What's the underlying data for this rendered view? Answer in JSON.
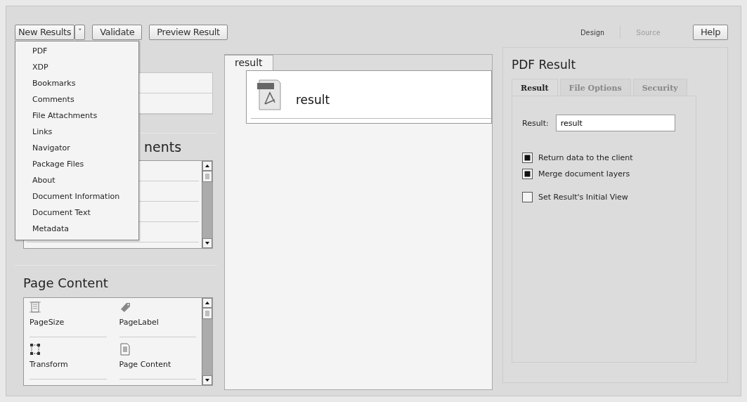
{
  "toolbar": {
    "new_results": "New Results",
    "caret": "˅",
    "buttons": [
      "Validate",
      "Preview Result"
    ],
    "views": [
      {
        "label": "Design",
        "selected": true
      },
      {
        "label": "Source",
        "selected": false
      }
    ],
    "help": "Help"
  },
  "menu": [
    "PDF",
    "XDP",
    "Bookmarks",
    "Comments",
    "File Attachments",
    "Links",
    "Navigator",
    "Package Files",
    "About",
    "Document Information",
    "Document Text",
    "Metadata"
  ],
  "left": {
    "components_heading": "nents",
    "page_content": {
      "title": "Page Content",
      "items": [
        {
          "label": "PageSize",
          "kind": "pagesize"
        },
        {
          "label": "PageLabel",
          "kind": "tag"
        },
        {
          "label": "Transform",
          "kind": "transform"
        },
        {
          "label": "Page Content",
          "kind": "page"
        }
      ]
    }
  },
  "canvas": {
    "tab": "result",
    "node": "result"
  },
  "properties": {
    "title": "PDF Result",
    "tabs": [
      {
        "label": "Result",
        "selected": true
      },
      {
        "label": "File Options",
        "selected": false
      },
      {
        "label": "Security",
        "selected": false
      }
    ],
    "field": {
      "label": "Result:",
      "value": "result"
    },
    "options": [
      {
        "label": "Return data to the client",
        "checked": true
      },
      {
        "label": "Merge document layers",
        "checked": true
      },
      {
        "label": "Set Result's Initial View",
        "checked": false
      }
    ]
  }
}
